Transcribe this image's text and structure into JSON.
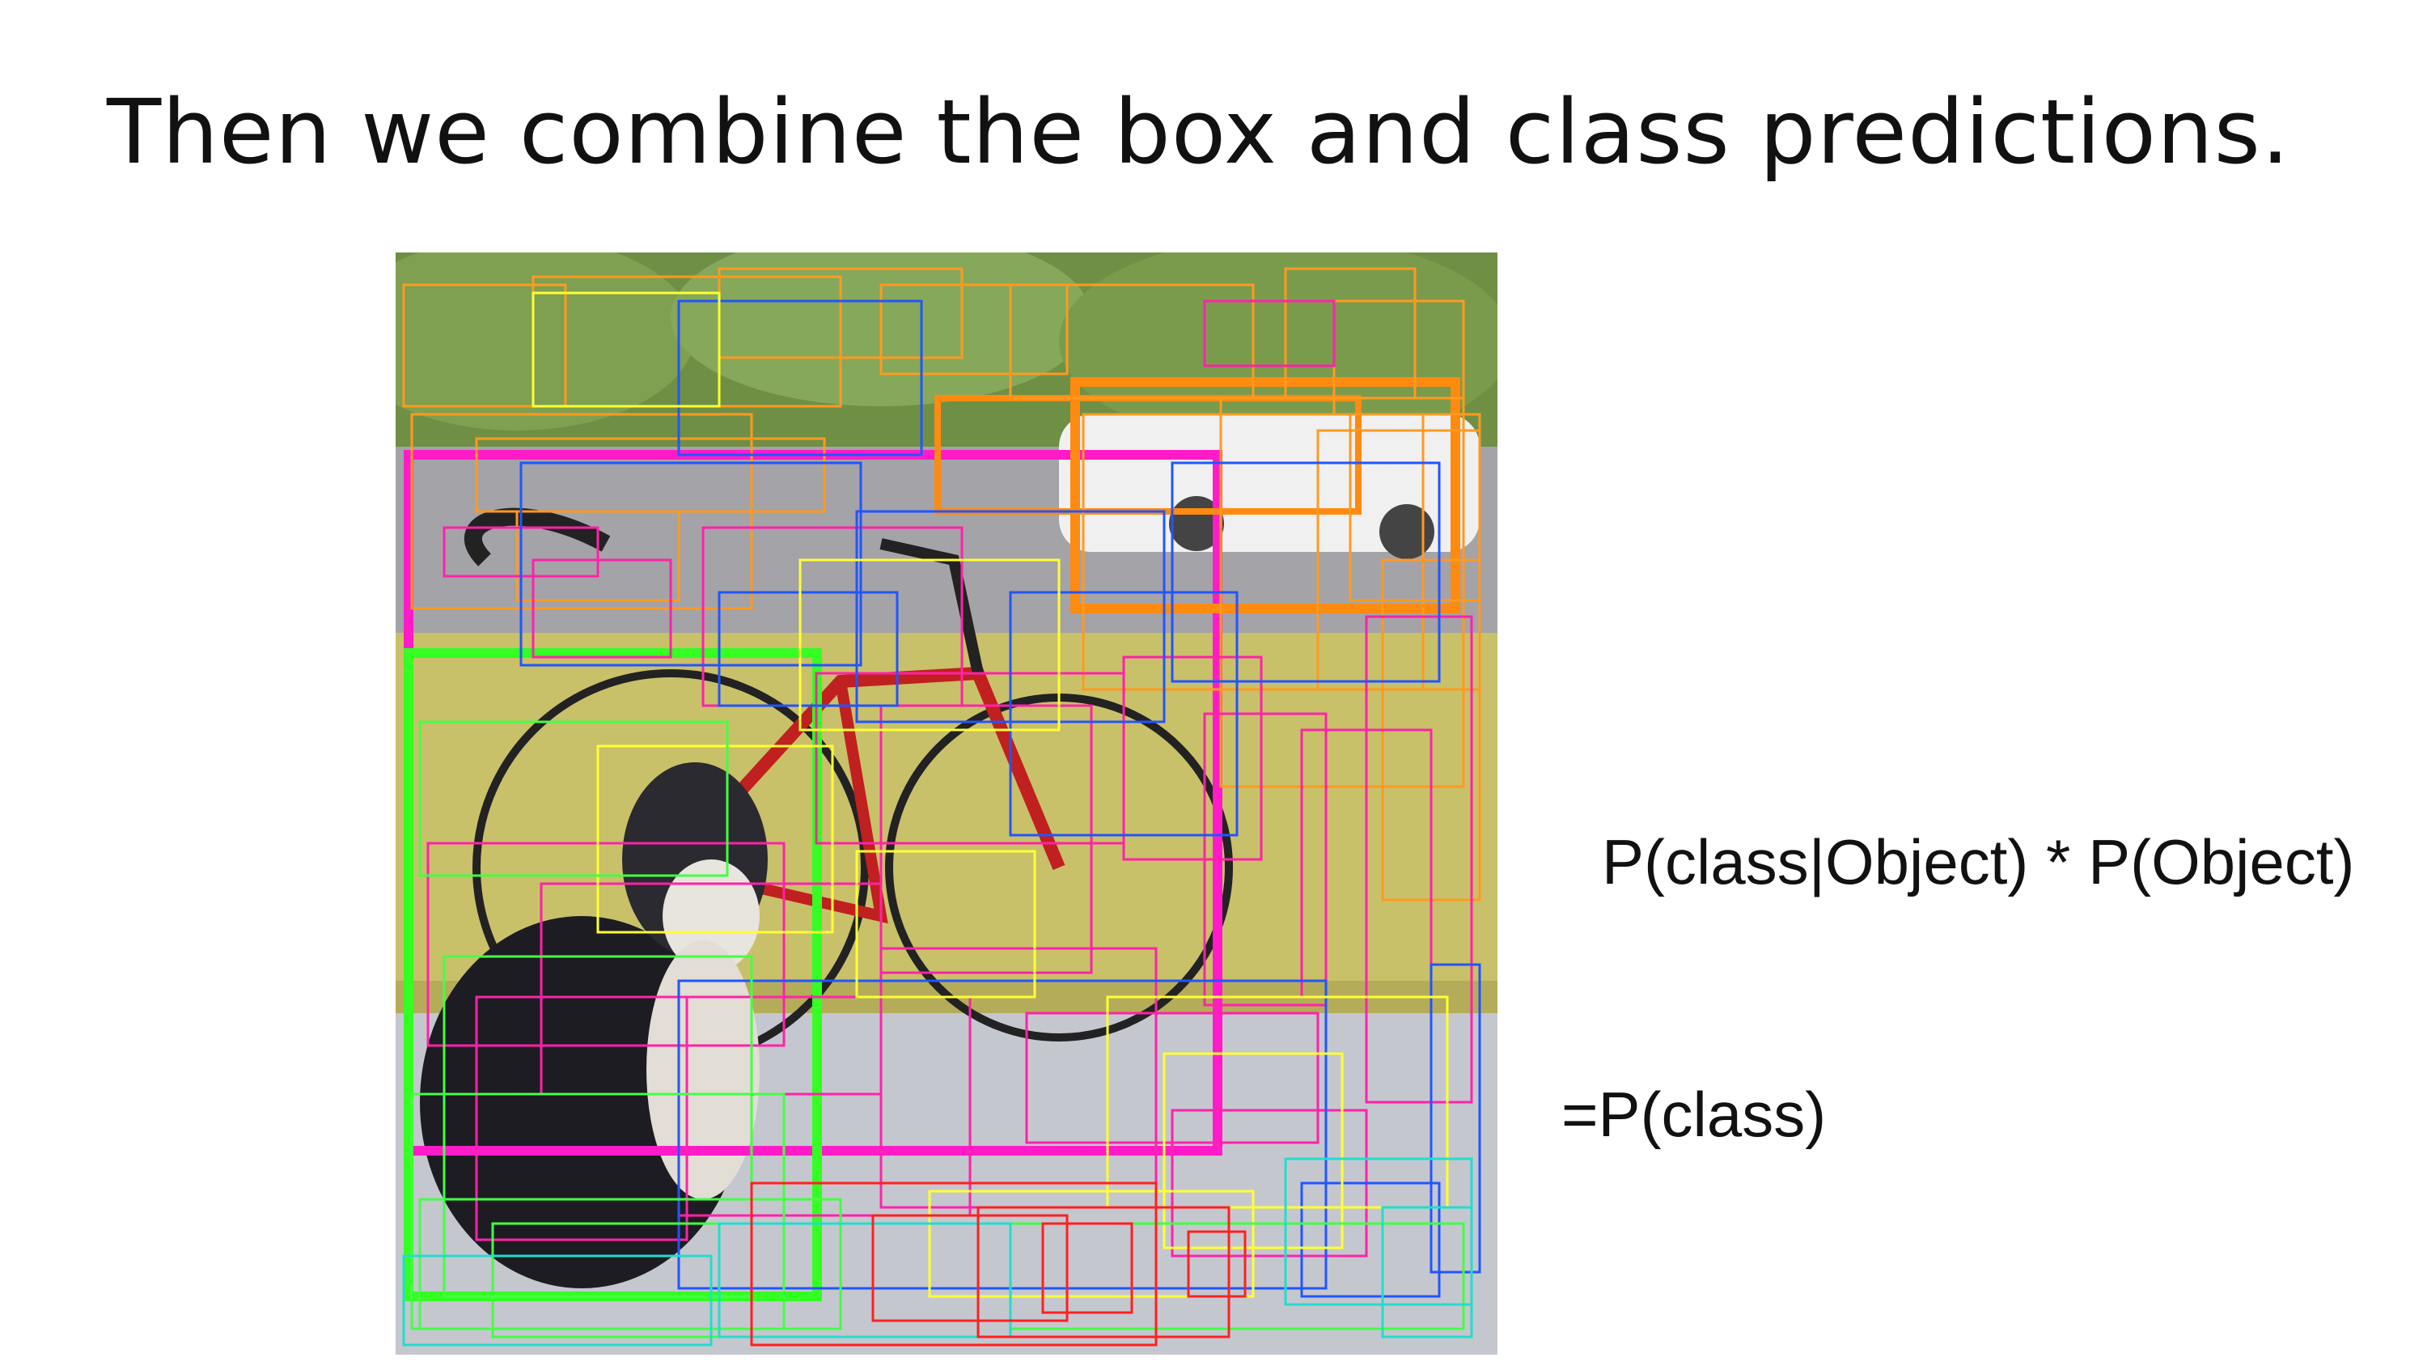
{
  "slide": {
    "title": "Then we combine the box and class predictions.",
    "formula_line1": "P(class|Object) * P(Object)",
    "formula_line2": "=P(class)"
  },
  "image": {
    "subject_icon": "bicycle-dog-photo",
    "box_colors": [
      "#ff00cc",
      "#ff8800",
      "#00ff00",
      "#2255ff",
      "#ffff00",
      "#ff0000",
      "#00ddcc",
      "#cc00ff"
    ]
  }
}
